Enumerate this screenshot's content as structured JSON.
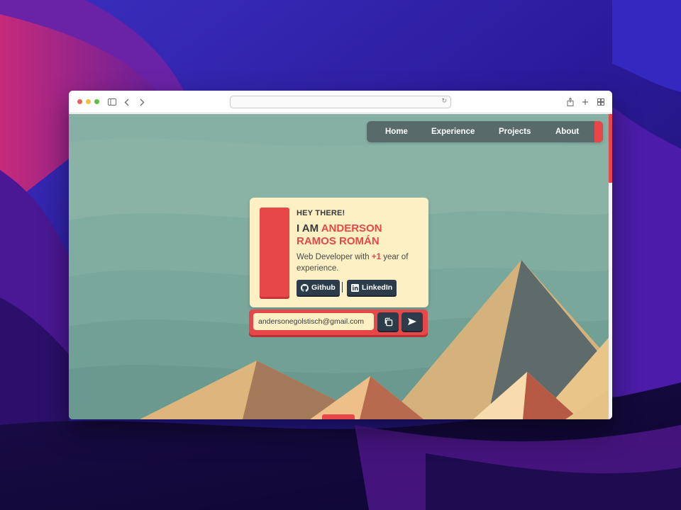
{
  "nav": {
    "items": [
      {
        "label": "Home"
      },
      {
        "label": "Experience"
      },
      {
        "label": "Projects"
      },
      {
        "label": "About"
      }
    ]
  },
  "hero": {
    "greeting": "HEY THERE!",
    "intro": "I AM ",
    "name": "ANDERSON RAMOS ROMÁN",
    "desc_before": "Web Developer with ",
    "desc_highlight": "+1",
    "desc_after": " year of experience.",
    "github_label": "Github",
    "linkedin_label": "LinkedIn"
  },
  "contact": {
    "email": "andersonegolstisch@gmail.com"
  },
  "colors": {
    "accent": "#e8474a",
    "card": "#fcf0c4",
    "dark_button": "#2d3c4b",
    "nav": "#586b6a",
    "sky": "#87b2a6"
  },
  "icons": [
    "sidebar-icon",
    "chevron-left-icon",
    "chevron-right-icon",
    "reload-icon",
    "share-icon",
    "plus-icon",
    "grid-icon",
    "github-icon",
    "linkedin-icon",
    "copy-icon",
    "send-icon"
  ]
}
